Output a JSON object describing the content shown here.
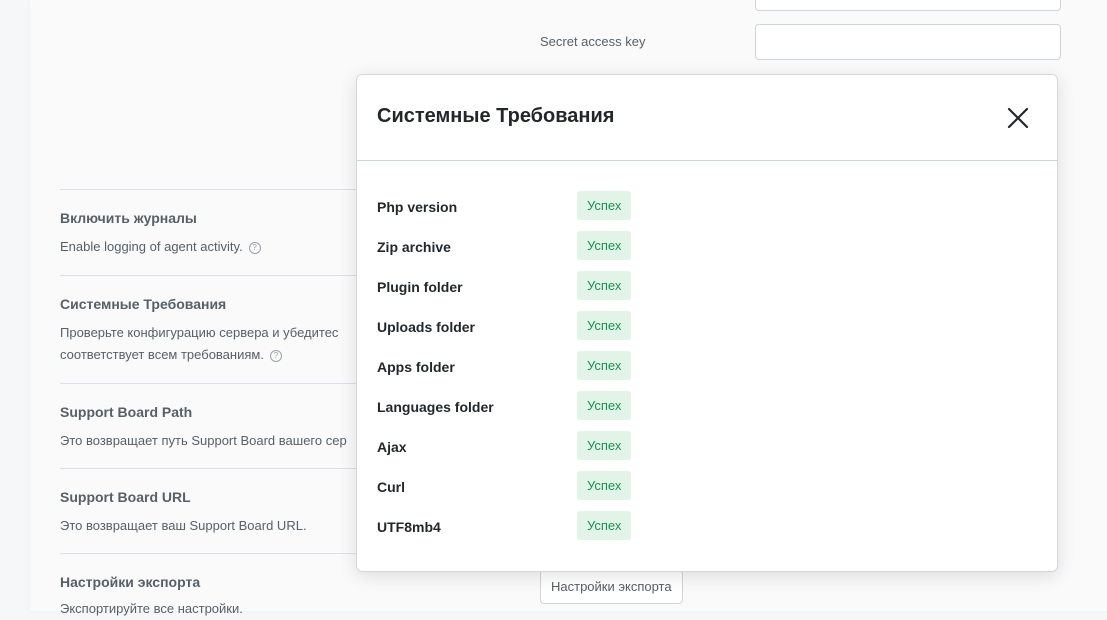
{
  "background": {
    "secret_key_label": "Secret access key",
    "enable_logs": {
      "title": "Включить журналы",
      "description": "Enable logging of agent activity."
    },
    "system_requirements": {
      "title": "Системные Требования",
      "description_line1": "Проверьте конфигурацию сервера и убедитес",
      "description_line2": "соответствует всем требованиям."
    },
    "board_path": {
      "title": "Support Board Path",
      "description": "Это возвращает путь Support Board вашего сер"
    },
    "board_url": {
      "title": "Support Board URL",
      "description": "Это возвращает ваш Support Board URL."
    },
    "export_settings": {
      "title": "Настройки экспорта",
      "description": "Экспортируйте все настройки.",
      "button_label": "Настройки экспорта"
    },
    "help_glyph": "?"
  },
  "modal": {
    "title": "Системные Требования",
    "close_icon": "close-icon",
    "requirements": [
      {
        "name": "Php version",
        "status": "Успех"
      },
      {
        "name": "Zip archive",
        "status": "Успех"
      },
      {
        "name": "Plugin folder",
        "status": "Успех"
      },
      {
        "name": "Uploads folder",
        "status": "Успех"
      },
      {
        "name": "Apps folder",
        "status": "Успех"
      },
      {
        "name": "Languages folder",
        "status": "Успех"
      },
      {
        "name": "Ajax",
        "status": "Успех"
      },
      {
        "name": "Curl",
        "status": "Успех"
      },
      {
        "name": "UTF8mb4",
        "status": "Успех"
      }
    ]
  },
  "colors": {
    "success_bg": "#e2f4e8",
    "success_text": "#1a9250",
    "title_text": "#24272a",
    "muted_text": "#566069"
  }
}
